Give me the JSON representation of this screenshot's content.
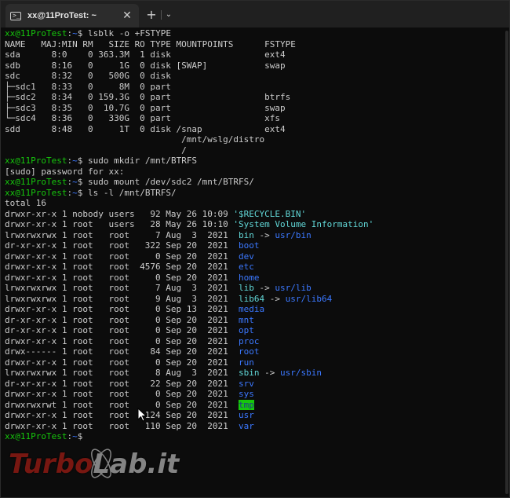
{
  "tab": {
    "title": "xx@11ProTest: ~",
    "icon": "terminal-icon",
    "new_tab_label": "+",
    "dropdown_icon": "chevron-down-icon"
  },
  "prompt": {
    "user": "xx@11ProTest",
    "path": "~",
    "sep": ":",
    "dollar": "$"
  },
  "cmds": {
    "lsblk": "lsblk -o +FSTYPE",
    "mkdir": "sudo mkdir /mnt/BTRFS",
    "sudo_pw": "[sudo] password for xx:",
    "mount": "sudo mount /dev/sdc2 /mnt/BTRFS/",
    "ls": "ls -l /mnt/BTRFS/",
    "total": "total 16"
  },
  "lsblk": {
    "header": "NAME   MAJ:MIN RM   SIZE RO TYPE MOUNTPOINTS      FSTYPE",
    "rows": [
      "sda      8:0    0 363.3M  1 disk                  ext4",
      "sdb      8:16   0     1G  0 disk [SWAP]           swap",
      "sdc      8:32   0   500G  0 disk",
      "├─sdc1   8:33   0     8M  0 part",
      "├─sdc2   8:34   0 159.3G  0 part                  btrfs",
      "├─sdc3   8:35   0  10.7G  0 part                  swap",
      "└─sdc4   8:36   0   330G  0 part                  xfs",
      "sdd      8:48   0     1T  0 disk /snap            ext4",
      "                                  /mnt/wslg/distro",
      "                                  /"
    ]
  },
  "ls": [
    {
      "meta": "drwxr-xr-x 1 nobody users   92 May 26 10:09 ",
      "name": "'$RECYCLE.BIN'",
      "target": "",
      "style": "c"
    },
    {
      "meta": "drwxr-xr-x 1 root   users   28 May 26 10:10 ",
      "name": "'System Volume Information'",
      "target": "",
      "style": "c"
    },
    {
      "meta": "lrwxrwxrwx 1 root   root     7 Aug  3  2021  ",
      "name": "bin",
      "target": "usr/bin",
      "style": "c"
    },
    {
      "meta": "dr-xr-xr-x 1 root   root   322 Sep 20  2021  ",
      "name": "boot",
      "target": "",
      "style": "b"
    },
    {
      "meta": "drwxr-xr-x 1 root   root     0 Sep 20  2021  ",
      "name": "dev",
      "target": "",
      "style": "b"
    },
    {
      "meta": "drwxr-xr-x 1 root   root  4576 Sep 20  2021  ",
      "name": "etc",
      "target": "",
      "style": "b"
    },
    {
      "meta": "drwxr-xr-x 1 root   root     0 Sep 20  2021  ",
      "name": "home",
      "target": "",
      "style": "b"
    },
    {
      "meta": "lrwxrwxrwx 1 root   root     7 Aug  3  2021  ",
      "name": "lib",
      "target": "usr/lib",
      "style": "c"
    },
    {
      "meta": "lrwxrwxrwx 1 root   root     9 Aug  3  2021  ",
      "name": "lib64",
      "target": "usr/lib64",
      "style": "c"
    },
    {
      "meta": "drwxr-xr-x 1 root   root     0 Sep 13  2021  ",
      "name": "media",
      "target": "",
      "style": "b"
    },
    {
      "meta": "dr-xr-xr-x 1 root   root     0 Sep 20  2021  ",
      "name": "mnt",
      "target": "",
      "style": "b"
    },
    {
      "meta": "dr-xr-xr-x 1 root   root     0 Sep 20  2021  ",
      "name": "opt",
      "target": "",
      "style": "b"
    },
    {
      "meta": "drwxr-xr-x 1 root   root     0 Sep 20  2021  ",
      "name": "proc",
      "target": "",
      "style": "b"
    },
    {
      "meta": "drwx------ 1 root   root    84 Sep 20  2021  ",
      "name": "root",
      "target": "",
      "style": "b"
    },
    {
      "meta": "drwxr-xr-x 1 root   root     0 Sep 20  2021  ",
      "name": "run",
      "target": "",
      "style": "b"
    },
    {
      "meta": "lrwxrwxrwx 1 root   root     8 Aug  3  2021  ",
      "name": "sbin",
      "target": "usr/sbin",
      "style": "c"
    },
    {
      "meta": "dr-xr-xr-x 1 root   root    22 Sep 20  2021  ",
      "name": "srv",
      "target": "",
      "style": "b"
    },
    {
      "meta": "drwxr-xr-x 1 root   root     0 Sep 20  2021  ",
      "name": "sys",
      "target": "",
      "style": "b"
    },
    {
      "meta": "drwxrwxrwt 1 root   root     0 Sep 20  2021  ",
      "name": "tmp",
      "target": "",
      "style": "hl"
    },
    {
      "meta": "drwxr-xr-x 1 root   root   124 Sep 20  2021  ",
      "name": "usr",
      "target": "",
      "style": "b"
    },
    {
      "meta": "drwxr-xr-x 1 root   root   110 Sep 20  2021  ",
      "name": "var",
      "target": "",
      "style": "b"
    }
  ],
  "arrow": " -> ",
  "watermark": {
    "part1": "Turbo",
    "part2": "Lab.it"
  },
  "colors": {
    "prompt_user": "#16c60c",
    "prompt_path": "#3b78ff",
    "dir": "#3b78ff",
    "link": "#61d6d6",
    "sticky_bg": "#16c60c",
    "text": "#cccccc",
    "background": "#0c0c0c"
  }
}
